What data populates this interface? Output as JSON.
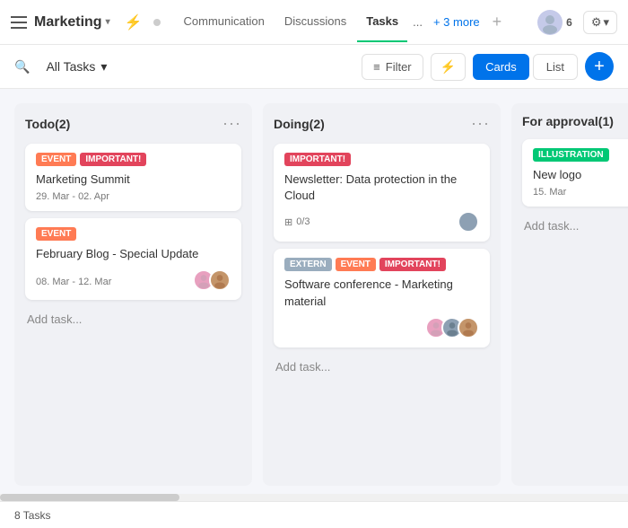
{
  "nav": {
    "hamburger_label": "menu",
    "brand": "Marketing",
    "brand_chevron": "▾",
    "pulse_icon": "⚡",
    "tabs": [
      {
        "label": "Communication",
        "active": false
      },
      {
        "label": "Discussions",
        "active": false
      },
      {
        "label": "Tasks",
        "active": true
      },
      {
        "label": "...",
        "active": false
      }
    ],
    "plus_more": "+ 3 more",
    "nav_add": "+",
    "avatar_count": "6",
    "settings_label": "⚙",
    "settings_chevron": "▾"
  },
  "toolbar": {
    "search_icon": "🔍",
    "all_tasks": "All Tasks",
    "all_tasks_chevron": "▾",
    "filter_label": "Filter",
    "filter_icon": "≡",
    "activity_icon": "⚡",
    "cards_label": "Cards",
    "list_label": "List",
    "add_icon": "+"
  },
  "board": {
    "columns": [
      {
        "id": "todo",
        "title": "Todo(2)",
        "cards": [
          {
            "tags": [
              "EVENT",
              "IMPORTANT!"
            ],
            "tag_types": [
              "event",
              "important"
            ],
            "title": "Marketing Summit",
            "date": "29. Mar - 02. Apr",
            "avatars": [],
            "subtask": null
          },
          {
            "tags": [
              "EVENT"
            ],
            "tag_types": [
              "event"
            ],
            "title": "February Blog - Special Update",
            "date": "08. Mar - 12. Mar",
            "avatars": [
              "pink",
              "brown"
            ],
            "subtask": null
          }
        ],
        "add_task": "Add task..."
      },
      {
        "id": "doing",
        "title": "Doing(2)",
        "cards": [
          {
            "tags": [
              "IMPORTANT!"
            ],
            "tag_types": [
              "important"
            ],
            "title": "Newsletter: Data protection in the Cloud",
            "date": null,
            "avatars": [
              "gray"
            ],
            "subtask": "0/3"
          },
          {
            "tags": [
              "EXTERN",
              "EVENT",
              "IMPORTANT!"
            ],
            "tag_types": [
              "extern",
              "event",
              "important"
            ],
            "title": "Software conference - Marketing material",
            "date": null,
            "avatars": [
              "pink",
              "gray",
              "brown"
            ],
            "subtask": null
          }
        ],
        "add_task": "Add task..."
      },
      {
        "id": "approval",
        "title": "For approval(1)",
        "cards": [
          {
            "tags": [
              "ILLUSTRATION"
            ],
            "tag_types": [
              "illustration"
            ],
            "title": "New logo",
            "date": "15. Mar",
            "avatars": [],
            "subtask": null
          }
        ],
        "add_task": "Add task..."
      }
    ]
  },
  "statusbar": {
    "task_count": "8 Tasks"
  }
}
